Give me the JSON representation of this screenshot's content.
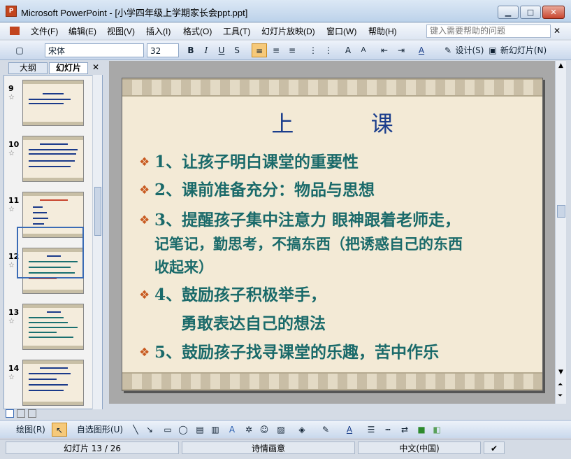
{
  "window": {
    "title": "Microsoft PowerPoint - [小学四年级上学期家长会ppt.ppt]",
    "app_icon": "powerpoint-icon"
  },
  "menu": [
    "文件(F)",
    "编辑(E)",
    "视图(V)",
    "插入(I)",
    "格式(O)",
    "工具(T)",
    "幻灯片放映(D)",
    "窗口(W)",
    "帮助(H)"
  ],
  "help_placeholder": "键入需要帮助的问题",
  "toolbar": {
    "font": "宋体",
    "size": "32",
    "bold": "B",
    "italic": "I",
    "underline": "U",
    "shadow": "S",
    "design": "设计(S)",
    "new_slide": "新幻灯片(N)"
  },
  "panel": {
    "tab_outline": "大纲",
    "tab_slides": "幻灯片"
  },
  "thumbnails": [
    {
      "num": "9"
    },
    {
      "num": "10"
    },
    {
      "num": "11"
    },
    {
      "num": "12"
    },
    {
      "num": "13"
    },
    {
      "num": "14"
    }
  ],
  "slide": {
    "title": "上 课",
    "lines": [
      "1、让孩子明白课堂的重要性",
      "2、课前准备充分：物品与思想",
      "3、提醒孩子集中注意力  眼神跟着老师走，",
      "记笔记，勤思考，不搞东西（把诱惑自己的东西",
      "收起来）",
      "4、鼓励孩子积极举手，",
      "勇敢表达自己的想法",
      "5、鼓励孩子找寻课堂的乐趣，苦中作乐"
    ]
  },
  "drawbar": {
    "draw": "绘图(R)",
    "autoshapes": "自选图形(U)"
  },
  "status": {
    "slide": "幻灯片 13 / 26",
    "design": "诗情画意",
    "lang": "中文(中国)"
  }
}
